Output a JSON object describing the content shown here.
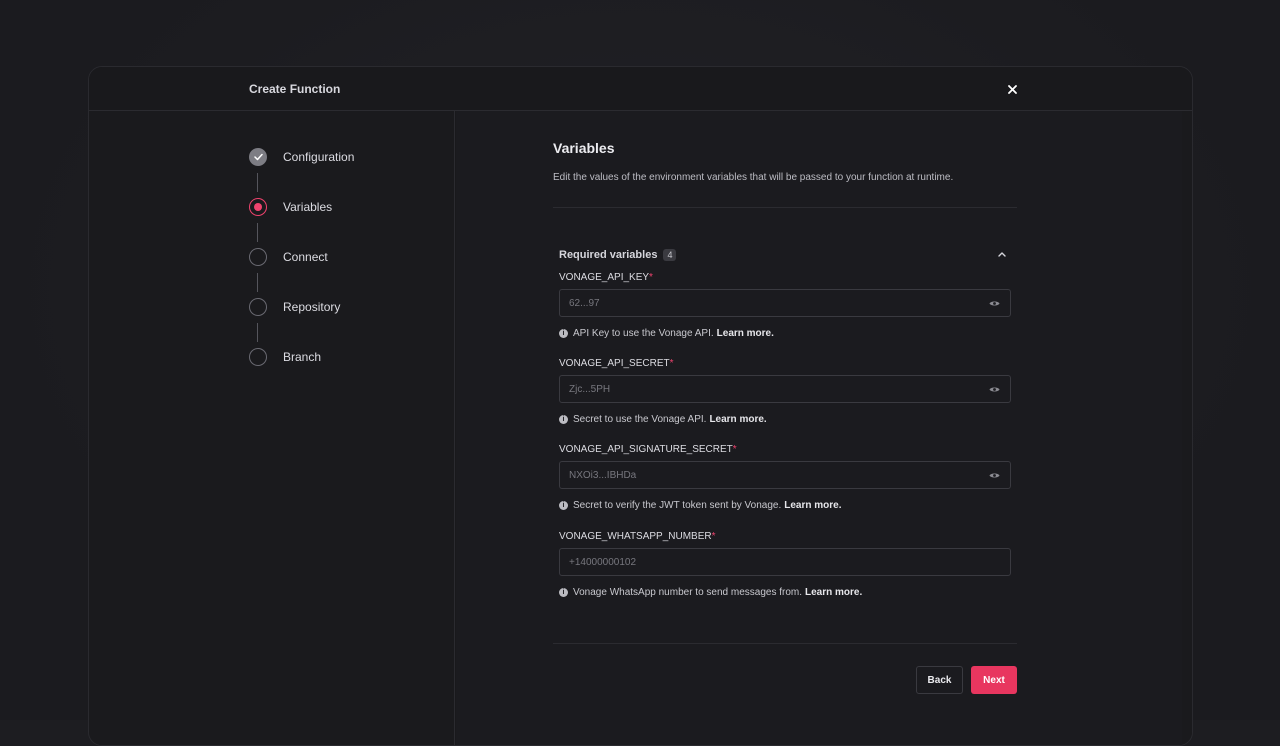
{
  "modal": {
    "title": "Create Function"
  },
  "steps": [
    {
      "label": "Configuration",
      "state": "done"
    },
    {
      "label": "Variables",
      "state": "active"
    },
    {
      "label": "Connect",
      "state": "pending"
    },
    {
      "label": "Repository",
      "state": "pending"
    },
    {
      "label": "Branch",
      "state": "pending"
    }
  ],
  "section": {
    "title": "Variables",
    "description": "Edit the values of the environment variables that will be passed to your function at runtime."
  },
  "group": {
    "title": "Required variables",
    "count": "4"
  },
  "fields": [
    {
      "name": "VONAGE_API_KEY",
      "required_mark": "*",
      "placeholder": "62...97",
      "help": "API Key to use the Vonage API.",
      "link": "Learn more."
    },
    {
      "name": "VONAGE_API_SECRET",
      "required_mark": "*",
      "placeholder": "Zjc...5PH",
      "help": "Secret to use the Vonage API.",
      "link": "Learn more."
    },
    {
      "name": "VONAGE_API_SIGNATURE_SECRET",
      "required_mark": "*",
      "placeholder": "NXOi3...IBHDa",
      "help": "Secret to verify the JWT token sent by Vonage.",
      "link": "Learn more."
    },
    {
      "name": "VONAGE_WHATSAPP_NUMBER",
      "required_mark": "*",
      "placeholder": "+14000000102",
      "help": "Vonage WhatsApp number to send messages from.",
      "link": "Learn more."
    }
  ],
  "buttons": {
    "back": "Back",
    "next": "Next"
  },
  "colors": {
    "accent": "#e8365f",
    "background": "#1b1b1f"
  }
}
